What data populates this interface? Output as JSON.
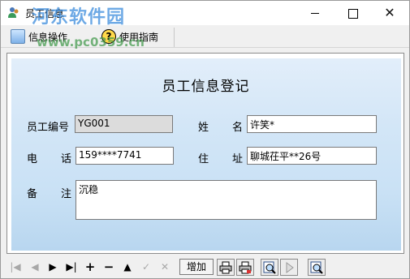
{
  "window": {
    "title": "员工信息",
    "watermark": "河东软件园",
    "watermark_url": "www.pc0359.cn"
  },
  "menu": {
    "items": [
      {
        "label": "信息操作",
        "icon": "info-icon"
      },
      {
        "label": "使用指南",
        "icon": "help-icon"
      }
    ]
  },
  "form": {
    "title": "员工信息登记",
    "id_label": "员工编号",
    "id_value": "YG001",
    "name_label_1": "姓",
    "name_label_2": "名",
    "name_value": "许笑*",
    "phone_label_1": "电",
    "phone_label_2": "话",
    "phone_value": "159****7741",
    "addr_label_1": "住",
    "addr_label_2": "址",
    "addr_value": "聊城茌平**26号",
    "note_label_1": "备",
    "note_label_2": "注",
    "note_value": "沉稳"
  },
  "navigator": {
    "first": "|◀",
    "prev": "◀",
    "next": "▶",
    "last": "▶|",
    "insert": "+",
    "delete": "−",
    "edit": "▲",
    "post": "✓",
    "cancel": "✕",
    "add_label": "增加"
  }
}
